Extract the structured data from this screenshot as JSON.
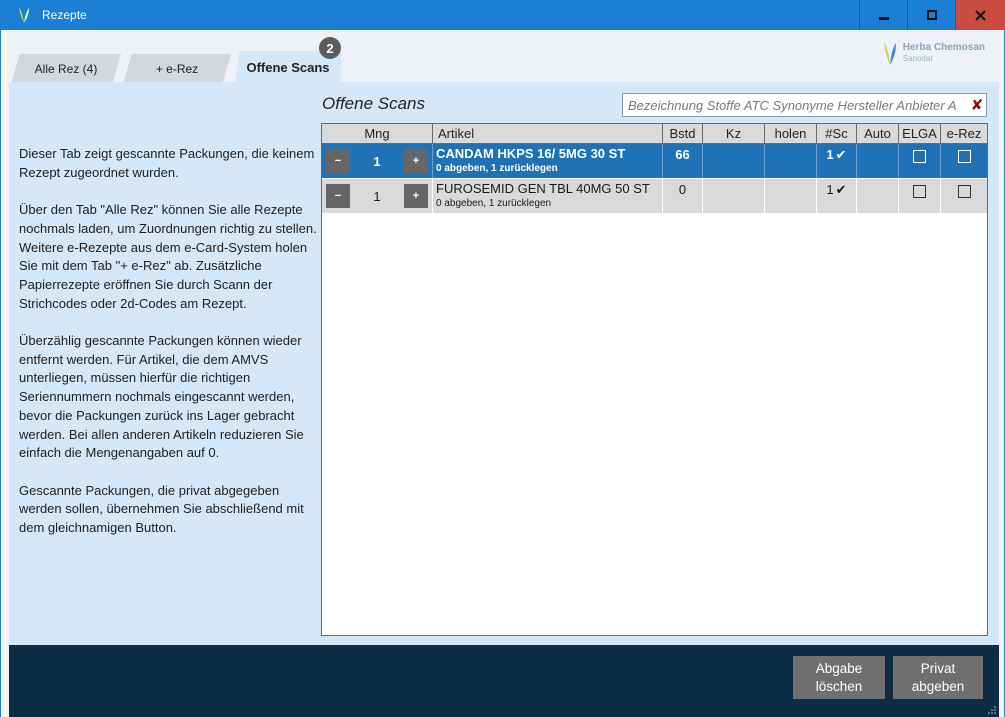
{
  "window": {
    "title": "Rezepte"
  },
  "tabs": [
    {
      "label": "Alle Rez (4)"
    },
    {
      "label": "+ e-Rez"
    },
    {
      "label": "Offene Scans",
      "badge": "2"
    }
  ],
  "logo": {
    "line1": "Herba Chemosan",
    "line2": "Sanodat"
  },
  "help": {
    "p1": "Dieser Tab zeigt gescannte Packungen, die keinem Rezept zugeordnet wurden.",
    "p2": "Über den Tab \"Alle Rez\" können Sie alle Rezepte nochmals laden, um Zuordnungen richtig zu stellen. Weitere e-Rezepte aus dem e-Card-System holen Sie mit dem Tab \"+ e-Rez\" ab. Zusätzliche Papierrezepte eröffnen Sie durch Scann der Strichcodes oder 2d-Codes am Rezept.",
    "p3": "Überzählig gescannte Packungen können wieder entfernt werden. Für Artikel, die dem AMVS unterliegen, müssen hierfür die richtigen Seriennummern nochmals eingescannt werden, bevor die Packungen zurück ins Lager gebracht werden. Bei allen anderen Artikeln reduzieren Sie einfach die Mengenangaben auf 0.",
    "p4": "Gescannte Packungen, die privat abgegeben werden sollen, übernehmen Sie abschließend mit dem gleichnamigen Button."
  },
  "panel": {
    "title": "Offene Scans",
    "search_placeholder": "Bezeichnung Stoffe ATC Synonyme Hersteller Anbieter A",
    "clear_glyph": "✘"
  },
  "grid": {
    "columns": [
      "Mng",
      "Artikel",
      "Bstd",
      "Kz",
      "holen",
      "#Sc",
      "Auto",
      "ELGA",
      "e-Rez"
    ],
    "rows": [
      {
        "qty": "1",
        "name": "CANDAM HKPS 16/ 5MG 30 ST",
        "sub": "0 abgeben, 1 zurücklegen",
        "bstd": "66",
        "kz": "",
        "holen": "",
        "sc": "1",
        "auto": "",
        "selected": true
      },
      {
        "qty": "1",
        "name": "FUROSEMID GEN TBL 40MG 50 ST",
        "sub": "0 abgeben, 1 zurücklegen",
        "bstd": "0",
        "kz": "",
        "holen": "",
        "sc": "1",
        "auto": "",
        "selected": false
      }
    ],
    "minus": "−",
    "plus": "+",
    "check": "✔"
  },
  "footer": {
    "abgabe_line1": "Abgabe",
    "abgabe_line2": "löschen",
    "privat_line1": "Privat",
    "privat_line2": "abgeben"
  },
  "colors": {
    "titlebar": "#1b7fd6",
    "close": "#c94b40",
    "selected_row": "#1e72b5",
    "panel_bg": "#d4e8f8",
    "footer_bg": "#0c2d44"
  }
}
